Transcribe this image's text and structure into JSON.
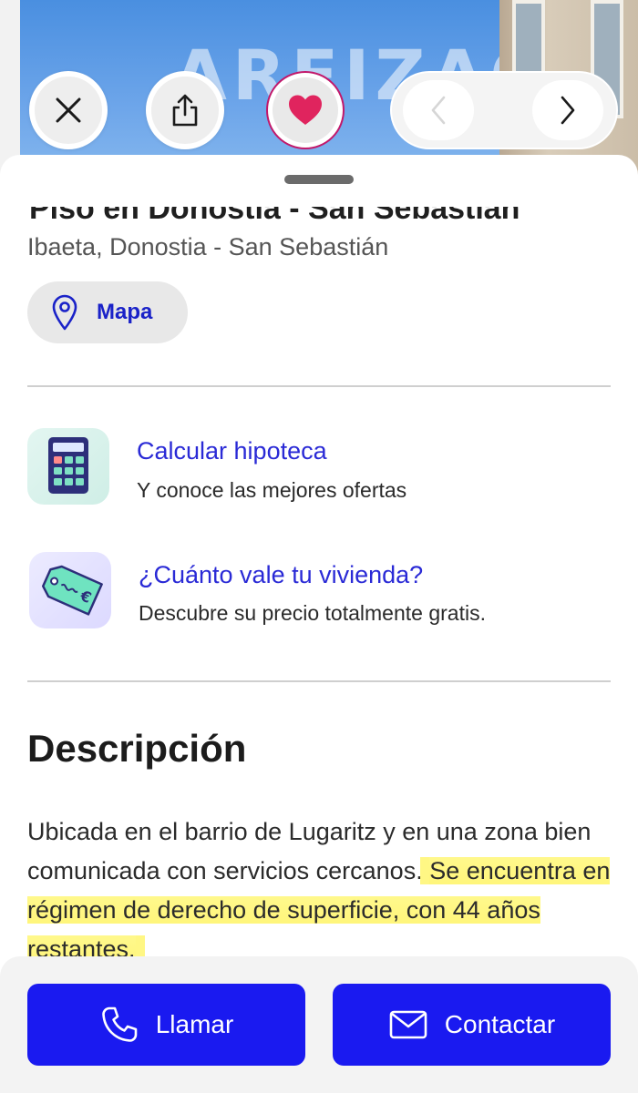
{
  "hero": {
    "sign_text": "AREIZAGA",
    "close_icon": "close-icon",
    "share_icon": "share-icon",
    "favorite_icon": "heart-icon",
    "favorite_color": "#e0245e",
    "prev_icon": "chevron-left-icon",
    "next_icon": "chevron-right-icon"
  },
  "listing": {
    "title": "Piso en Donostia - San Sebastián",
    "location": "Ibaeta, Donostia - San Sebastián",
    "map_label": "Mapa",
    "map_icon": "map-pin-icon"
  },
  "promos": [
    {
      "title": "Calcular hipoteca",
      "subtitle": "Y conoce las mejores ofertas",
      "icon": "calculator-icon"
    },
    {
      "title": "¿Cuánto vale tu vivienda?",
      "subtitle": "Descubre su precio totalmente gratis.",
      "icon": "price-tag-icon"
    }
  ],
  "description": {
    "heading": "Descripción",
    "line1": "Ubicada en el barrio de Lugaritz y en una zona bien comunicada con servicios cercanos.",
    "line2_highlighted": "Se encuentra en régimen de derecho de superficie, con 44 años restantes."
  },
  "actions": {
    "call_label": "Llamar",
    "call_icon": "phone-icon",
    "contact_label": "Contactar",
    "contact_icon": "mail-icon"
  },
  "colors": {
    "accent_blue": "#1a1af0",
    "link_blue": "#2a2ad6",
    "highlight_yellow": "#fff46e"
  }
}
